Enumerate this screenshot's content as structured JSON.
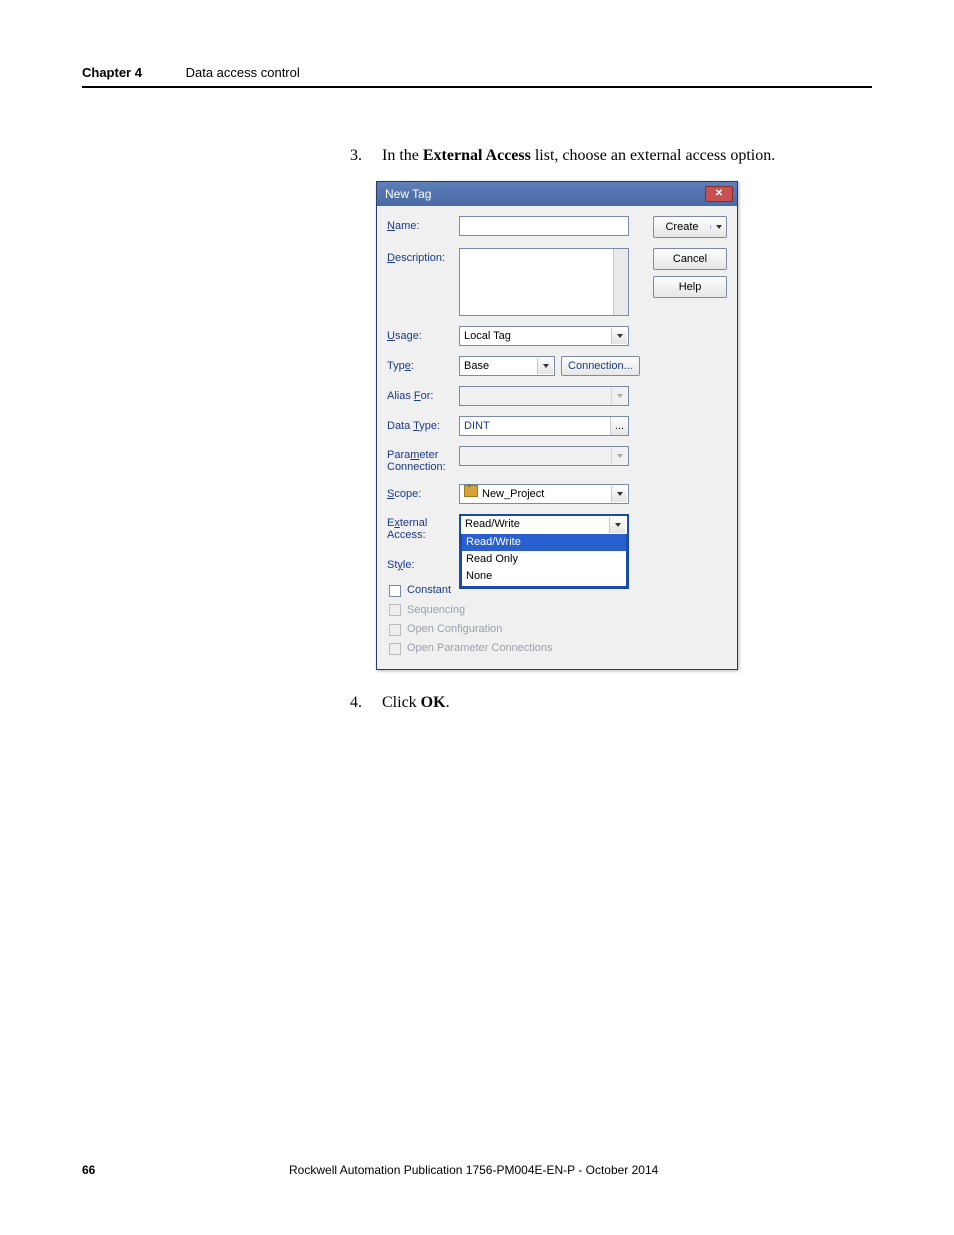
{
  "header": {
    "chapter_label": "Chapter 4",
    "section_title": "Data access control"
  },
  "steps": {
    "s3": {
      "num": "3.",
      "pre": "In the ",
      "bold": "External Access",
      "post": " list, choose an external access option."
    },
    "s4": {
      "num": "4.",
      "pre": "Click ",
      "bold": "OK",
      "post": "."
    }
  },
  "dialog": {
    "title": "New Tag",
    "close_glyph": "✕",
    "buttons": {
      "create": "Create",
      "cancel": "Cancel",
      "help": "Help"
    },
    "labels": {
      "name": "Name:",
      "description": "Description:",
      "usage": "Usage:",
      "type": "Type:",
      "alias_for": "Alias For:",
      "data_type": "Data Type:",
      "param_conn": "Parameter Connection:",
      "scope": "Scope:",
      "external_access": "External Access:",
      "style": "Style:"
    },
    "values": {
      "name": "",
      "description": "",
      "usage": "Local Tag",
      "type": "Base",
      "connection_btn": "Connection...",
      "alias_for": "",
      "data_type": "DINT",
      "ellipsis": "...",
      "param_conn": "",
      "scope": "New_Project",
      "external_access_selected": "Read/Write",
      "style": ""
    },
    "external_access_options": [
      "Read/Write",
      "Read Only",
      "None"
    ],
    "checkboxes": {
      "constant": "Constant",
      "sequencing": "Sequencing",
      "open_config": "Open Configuration",
      "open_param_conn": "Open Parameter Connections"
    }
  },
  "footer": {
    "page_number": "66",
    "publication": "Rockwell Automation Publication 1756-PM004E-EN-P - October 2014"
  }
}
